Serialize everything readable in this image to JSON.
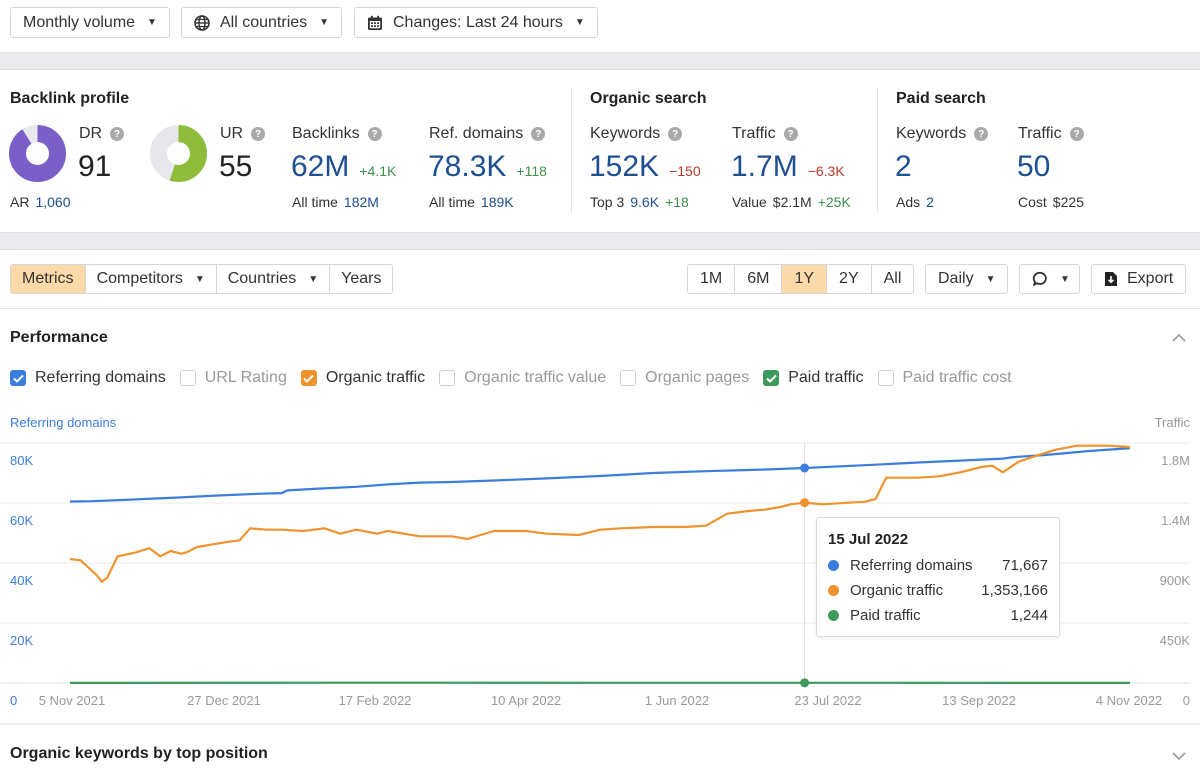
{
  "filters": {
    "volume": "Monthly volume",
    "countries": "All countries",
    "changes": "Changes: Last 24 hours"
  },
  "backlink_profile": {
    "title": "Backlink profile",
    "dr": {
      "label": "DR",
      "value": "91",
      "fraction": 0.91,
      "color": "#7a5fc8"
    },
    "ar": {
      "label": "AR",
      "value": "1,060"
    },
    "ur": {
      "label": "UR",
      "value": "55",
      "fraction": 0.55,
      "color": "#8fbc3b"
    },
    "backlinks": {
      "label": "Backlinks",
      "value": "62M",
      "delta": "+4.1K",
      "sub_label": "All time",
      "sub_value": "182M"
    },
    "ref_domains": {
      "label": "Ref. domains",
      "value": "78.3K",
      "delta": "+118",
      "sub_label": "All time",
      "sub_value": "189K"
    }
  },
  "organic_search": {
    "title": "Organic search",
    "keywords": {
      "label": "Keywords",
      "value": "152K",
      "delta": "−150",
      "sub_label": "Top 3",
      "sub_value": "9.6K",
      "sub_delta": "+18"
    },
    "traffic": {
      "label": "Traffic",
      "value": "1.7M",
      "delta": "−6.3K",
      "sub_label": "Value",
      "sub_value": "$2.1M",
      "sub_delta": "+25K"
    }
  },
  "paid_search": {
    "title": "Paid search",
    "keywords": {
      "label": "Keywords",
      "value": "2",
      "sub_label": "Ads",
      "sub_value": "2"
    },
    "traffic": {
      "label": "Traffic",
      "value": "50",
      "sub_label": "Cost",
      "sub_value": "$225"
    }
  },
  "toolbar": {
    "tabs": [
      {
        "label": "Metrics",
        "active": true
      },
      {
        "label": "Competitors",
        "dropdown": true
      },
      {
        "label": "Countries",
        "dropdown": true
      },
      {
        "label": "Years"
      }
    ],
    "ranges": [
      {
        "label": "1M"
      },
      {
        "label": "6M"
      },
      {
        "label": "1Y",
        "active": true
      },
      {
        "label": "2Y"
      },
      {
        "label": "All"
      }
    ],
    "interval": "Daily",
    "export": "Export"
  },
  "performance": {
    "title": "Performance",
    "checkboxes": [
      {
        "label": "Referring domains",
        "checked": true,
        "color": "#3b7ddd"
      },
      {
        "label": "URL Rating",
        "checked": false
      },
      {
        "label": "Organic traffic",
        "checked": true,
        "color": "#f0922e"
      },
      {
        "label": "Organic traffic value",
        "checked": false
      },
      {
        "label": "Organic pages",
        "checked": false
      },
      {
        "label": "Paid traffic",
        "checked": true,
        "color": "#3e9a5a"
      },
      {
        "label": "Paid traffic cost",
        "checked": false
      }
    ]
  },
  "tooltip": {
    "date": "15 Jul 2022",
    "rows": [
      {
        "name": "Referring domains",
        "value": "71,667",
        "color": "#3b7ddd"
      },
      {
        "name": "Organic traffic",
        "value": "1,353,166",
        "color": "#f0922e"
      },
      {
        "name": "Paid traffic",
        "value": "1,244",
        "color": "#3e9a5a"
      }
    ]
  },
  "bottom_section": {
    "title": "Organic keywords by top position"
  },
  "chart_data": {
    "type": "line",
    "title": "Performance",
    "ylabel": "Referring domains",
    "y2label": "Traffic",
    "ylim": [
      0,
      80000
    ],
    "y2lim": [
      0,
      1800000
    ],
    "yticks": [
      "0",
      "20K",
      "40K",
      "60K",
      "80K"
    ],
    "y2ticks": [
      "0",
      "450K",
      "900K",
      "1.4M",
      "1.8M"
    ],
    "xticks": [
      "5 Nov 2021",
      "27 Dec 2021",
      "17 Feb 2022",
      "10 Apr 2022",
      "1 Jun 2022",
      "23 Jul 2022",
      "13 Sep 2022",
      "4 Nov 2022"
    ],
    "x_range": [
      "5 Nov 2021",
      "4 Nov 2022"
    ],
    "grid": true,
    "hover_date": "15 Jul 2022",
    "hover_fraction": 0.693,
    "series": [
      {
        "name": "Referring domains",
        "axis": "left",
        "color": "#3b7ddd",
        "x": [
          0,
          0.02,
          0.05,
          0.08,
          0.1,
          0.14,
          0.18,
          0.2,
          0.205,
          0.23,
          0.27,
          0.3,
          0.33,
          0.36,
          0.4,
          0.45,
          0.5,
          0.55,
          0.6,
          0.64,
          0.66,
          0.68,
          0.693,
          0.75,
          0.8,
          0.85,
          0.88,
          0.89,
          0.92,
          0.96,
          1.0
        ],
        "values": [
          60500,
          60600,
          61000,
          61500,
          61800,
          62500,
          63100,
          63300,
          64200,
          64700,
          65400,
          66200,
          66800,
          67000,
          67500,
          68200,
          69000,
          70000,
          70600,
          71000,
          71200,
          71500,
          71667,
          72600,
          73500,
          74300,
          74800,
          75300,
          76000,
          77300,
          78300
        ]
      },
      {
        "name": "Organic traffic",
        "axis": "right",
        "color": "#f0922e",
        "x": [
          0,
          0.01,
          0.025,
          0.03,
          0.035,
          0.045,
          0.06,
          0.075,
          0.085,
          0.095,
          0.105,
          0.11,
          0.12,
          0.135,
          0.15,
          0.16,
          0.17,
          0.185,
          0.2,
          0.22,
          0.24,
          0.255,
          0.27,
          0.29,
          0.3,
          0.33,
          0.36,
          0.375,
          0.4,
          0.43,
          0.45,
          0.48,
          0.5,
          0.52,
          0.55,
          0.58,
          0.6,
          0.62,
          0.64,
          0.655,
          0.67,
          0.68,
          0.693,
          0.71,
          0.75,
          0.76,
          0.77,
          0.8,
          0.82,
          0.84,
          0.86,
          0.87,
          0.88,
          0.895,
          0.91,
          0.93,
          0.95,
          0.98,
          1.0
        ],
        "values": [
          930000,
          920000,
          810000,
          760000,
          790000,
          950000,
          975000,
          1010000,
          950000,
          990000,
          970000,
          980000,
          1020000,
          1040000,
          1060000,
          1070000,
          1160000,
          1150000,
          1150000,
          1140000,
          1160000,
          1120000,
          1150000,
          1120000,
          1140000,
          1100000,
          1100000,
          1080000,
          1140000,
          1140000,
          1120000,
          1110000,
          1150000,
          1160000,
          1170000,
          1170000,
          1180000,
          1270000,
          1290000,
          1300000,
          1320000,
          1340000,
          1353166,
          1340000,
          1360000,
          1380000,
          1540000,
          1540000,
          1550000,
          1580000,
          1620000,
          1630000,
          1580000,
          1660000,
          1700000,
          1750000,
          1780000,
          1780000,
          1770000
        ]
      },
      {
        "name": "Paid traffic",
        "axis": "right",
        "color": "#3e9a5a",
        "x": [
          0,
          0.3,
          0.5,
          0.693,
          1.0
        ],
        "values": [
          1100,
          2400,
          1500,
          1244,
          900
        ]
      }
    ]
  }
}
